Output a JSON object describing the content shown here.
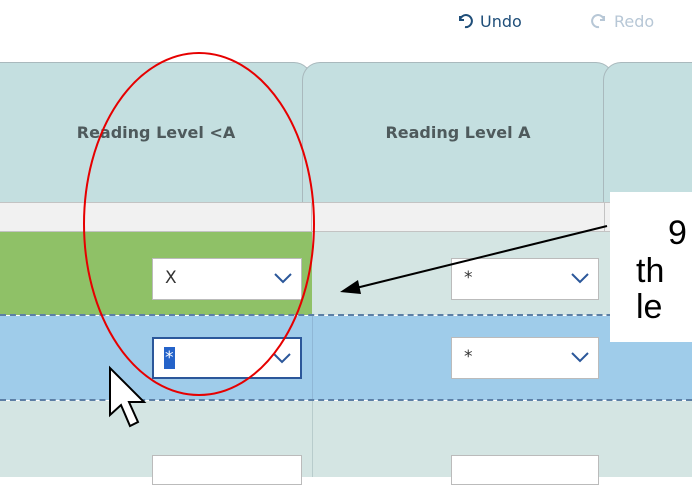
{
  "toolbar": {
    "undo_label": "Undo",
    "redo_label": "Redo"
  },
  "columns": [
    {
      "header": "Reading Level <A"
    },
    {
      "header": "Reading Level A"
    }
  ],
  "rows": [
    {
      "cells": [
        {
          "value": "X"
        },
        {
          "value": "*"
        }
      ],
      "highlight": "green"
    },
    {
      "cells": [
        {
          "value": "*"
        },
        {
          "value": "*"
        }
      ],
      "highlight": "blue",
      "active_cell": 0
    },
    {
      "cells": [
        {
          "value": ""
        },
        {
          "value": ""
        }
      ]
    }
  ],
  "annotation": {
    "text_fragments": [
      "9",
      "th",
      "le"
    ]
  },
  "colors": {
    "header_bg": "#c4dfe0",
    "row_green": "#8fc167",
    "row_light": "#d4e5e3",
    "row_blue": "#9fccea",
    "annotation_circle": "#e60000"
  }
}
